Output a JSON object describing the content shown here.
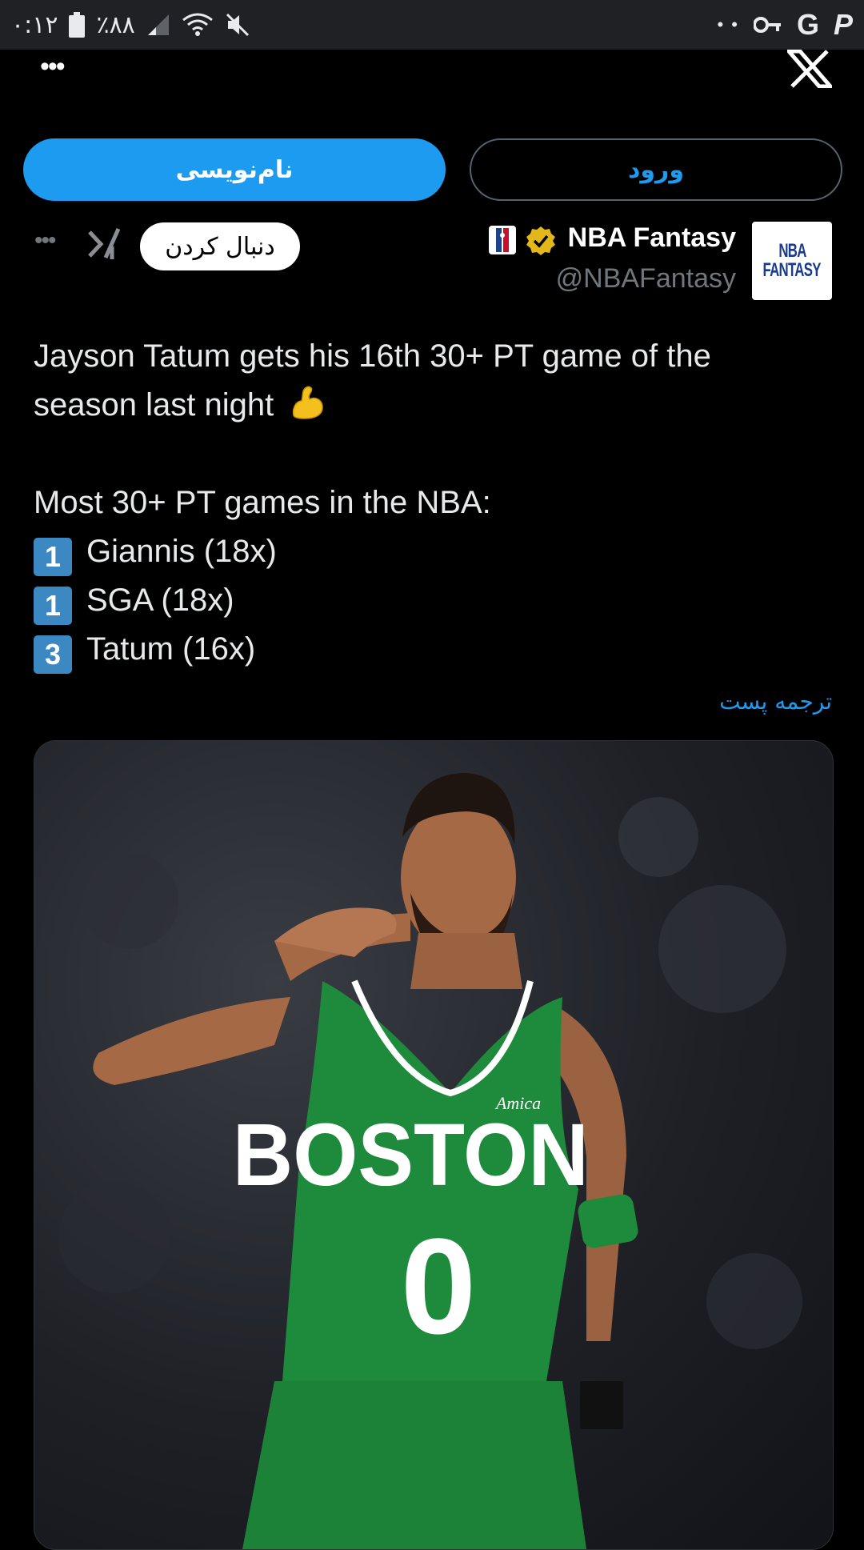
{
  "status_bar": {
    "time": "۰:۱۲",
    "battery": "٪۸۸",
    "icons": [
      "battery-icon",
      "signal-icon",
      "wifi-icon",
      "mute-icon",
      "more-dots-icon",
      "key-icon",
      "google-icon",
      "paypal-icon"
    ]
  },
  "auth": {
    "signup_label": "نام‌نویسی",
    "login_label": "ورود"
  },
  "author": {
    "name": "NBA Fantasy",
    "handle": "@NBAFantasy",
    "avatar_line1": "NBA",
    "avatar_line2": "FANTASY",
    "follow_label": "دنبال کردن"
  },
  "tweet": {
    "line1": "Jayson Tatum gets his 16th 30+ PT game of the",
    "line2": "season last night",
    "line3": "Most 30+ PT games in the NBA:",
    "ranks": [
      {
        "rank": "1",
        "text": "Giannis (18x)"
      },
      {
        "rank": "1",
        "text": "SGA (18x)"
      },
      {
        "rank": "3",
        "text": "Tatum (16x)"
      }
    ],
    "translate_label": "ترجمه پست"
  },
  "media": {
    "jersey_team": "BOSTON",
    "jersey_number": "0",
    "jersey_sponsor": "Amica"
  },
  "colors": {
    "accent": "#1d9bf0",
    "background": "#000000",
    "celtics_green": "#1e8a3c"
  }
}
